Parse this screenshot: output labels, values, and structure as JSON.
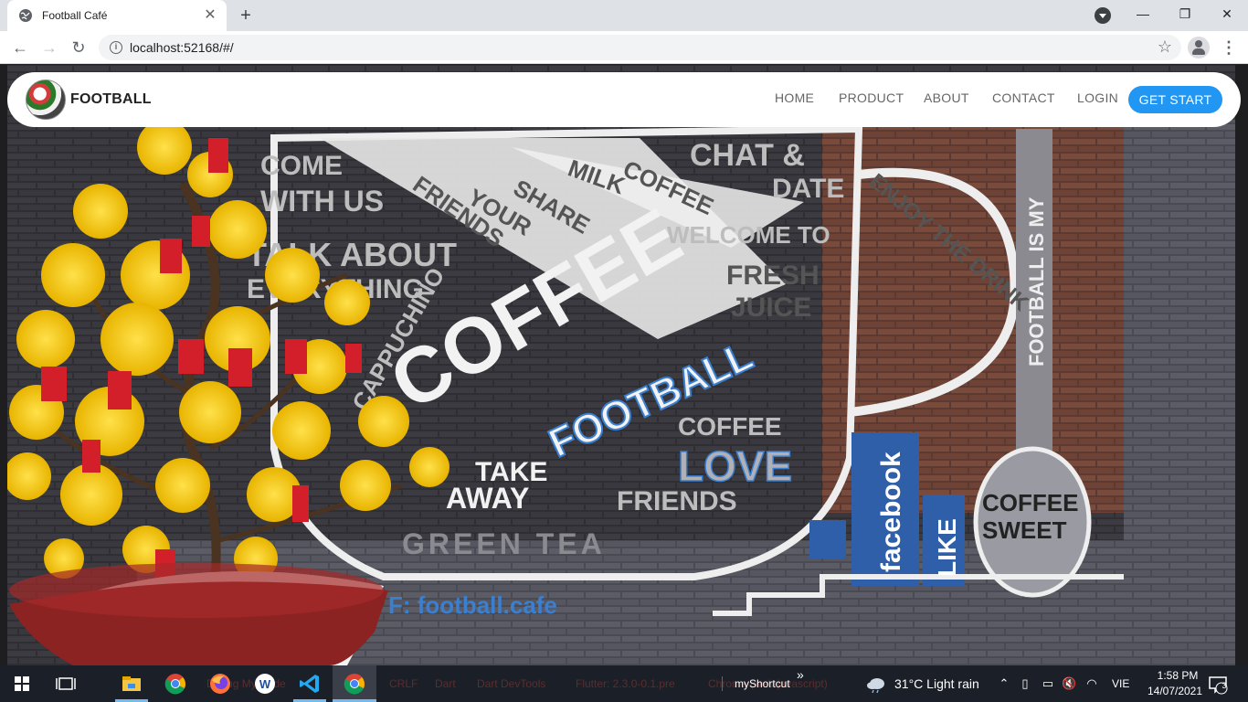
{
  "browser": {
    "tab_title": "Football Café",
    "url": "localhost:52168/#/",
    "new_tab_symbol": "+",
    "close_tab_symbol": "✕",
    "minimize_symbol": "—",
    "restore_symbol": "❐",
    "close_window_symbol": "✕",
    "back_symbol": "←",
    "forward_symbol": "→",
    "reload_symbol": "↻",
    "star_symbol": "☆",
    "menu_symbol": "⋮",
    "info_symbol": "i"
  },
  "navbar": {
    "brand": "FOOTBALL",
    "menu": [
      "HOME",
      "PRODUCT",
      "ABOUT",
      "CONTACT",
      "LOGIN"
    ],
    "cta": "GET START"
  },
  "wall_mural": {
    "lines": [
      "COME",
      "WITH US",
      "TALK ABOUT",
      "EVERYTHING",
      "SHARE",
      "YOUR",
      "FRIENDS",
      "MILK",
      "COFFEE",
      "CHAT &",
      "DATE",
      "WELCOME TO",
      "FRESH",
      "JUICE",
      "COFFEE",
      "FOOTBALL",
      "CAPPUCHINO",
      "TAKE",
      "AWAY",
      "COFFEE",
      "LOVE",
      "FRIENDS",
      "GREEN TEA",
      "F: football.cafe",
      "facebook",
      "LIKE",
      "COFFEE",
      "SWEET",
      "ENJOY THE DRINK",
      "FOOTBALL IS MY"
    ]
  },
  "taskbar": {
    "ghost_texts": [
      "Debug My Code",
      "CRLF",
      "Dart",
      "Dart DevTools",
      "Flutter: 2.3.0-0.1.pre",
      "Chrome (web-javascript)"
    ],
    "shortcut_label": "myShortcut",
    "chevron": "»",
    "weather": "31°C  Light rain",
    "lang": "VIE",
    "time": "1:58 PM",
    "date": "14/07/2021",
    "notification_count": "3"
  },
  "colors": {
    "accent": "#2196f3",
    "taskbar": "#1b1f27",
    "chrome_tabstrip": "#dee1e6"
  }
}
